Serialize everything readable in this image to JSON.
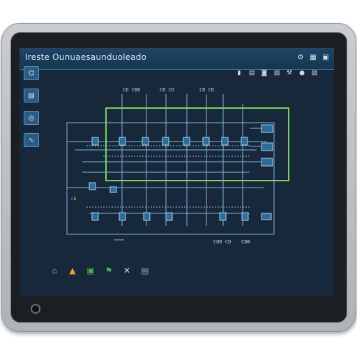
{
  "window": {
    "title": "Ireste Ounuaesaunduoleado"
  },
  "title_icons": [
    {
      "name": "settings-icon",
      "glyph": "⚙"
    },
    {
      "name": "grid-icon",
      "glyph": "▦"
    },
    {
      "name": "window-icon",
      "glyph": "▣"
    }
  ],
  "toolbar_icons": [
    {
      "name": "chart-icon",
      "glyph": "▮"
    },
    {
      "name": "save-icon",
      "glyph": "▤"
    },
    {
      "name": "camera-icon",
      "glyph": "◙"
    },
    {
      "name": "doc-icon",
      "glyph": "▧"
    },
    {
      "name": "wrench-icon",
      "glyph": "⚒"
    },
    {
      "name": "record-icon",
      "glyph": "●"
    },
    {
      "name": "layout-icon",
      "glyph": "▨"
    }
  ],
  "sidebar": [
    {
      "name": "sidebar-item-diagram",
      "glyph": "⌬"
    },
    {
      "name": "sidebar-item-library",
      "glyph": "▤"
    },
    {
      "name": "sidebar-item-devices",
      "glyph": "◎"
    },
    {
      "name": "sidebar-item-settings",
      "glyph": "∿"
    }
  ],
  "diagram": {
    "bus_labels": [
      "CD CBD",
      "CD CD",
      "CD CD"
    ],
    "bottom_labels": [
      "CDD CD",
      "CDB"
    ],
    "side_label": "CB"
  },
  "bottom_icons": [
    {
      "name": "home-icon",
      "glyph": "⌂",
      "color": "#4caf50"
    },
    {
      "name": "warning-icon",
      "glyph": "▲",
      "color": "#f0a020"
    },
    {
      "name": "module-icon",
      "glyph": "▣",
      "color": "#4caf50"
    },
    {
      "name": "flag-icon",
      "glyph": "⚑",
      "color": "#4caf50"
    },
    {
      "name": "tools-icon",
      "glyph": "✕",
      "color": "#c9d6e2"
    },
    {
      "name": "clipboard-icon",
      "glyph": "▤",
      "color": "#6fa8d6"
    }
  ],
  "colors": {
    "screen_bg": "#17283a",
    "line": "#7fb6df",
    "highlight": "#7dd35a",
    "accent": "#2b5b83"
  }
}
